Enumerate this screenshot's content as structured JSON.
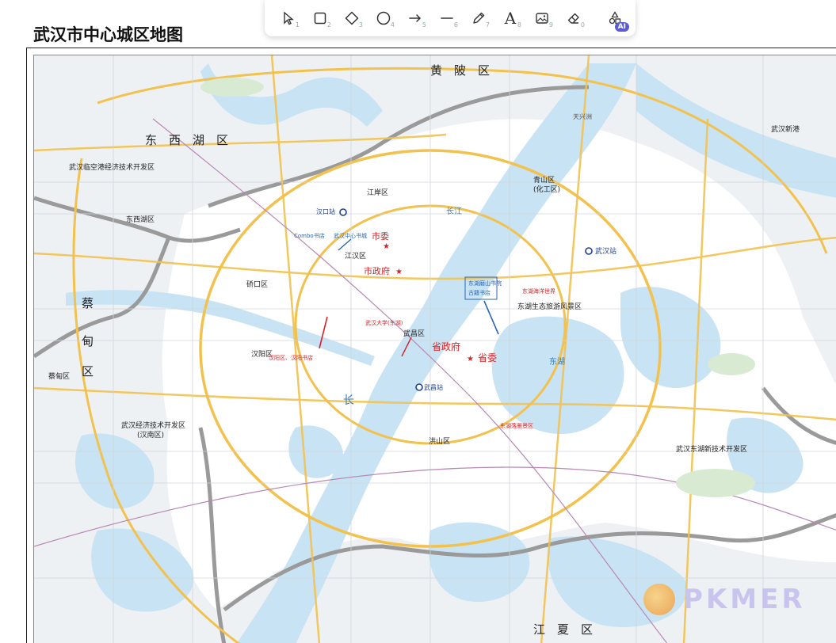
{
  "page": {
    "title": "武汉市中心城区地图"
  },
  "toolbar": {
    "tools": [
      {
        "icon": "select-arrow-icon",
        "key": "1"
      },
      {
        "icon": "rectangle-icon",
        "key": "2"
      },
      {
        "icon": "diamond-icon",
        "key": "3"
      },
      {
        "icon": "ellipse-icon",
        "key": "4"
      },
      {
        "icon": "arrow-icon",
        "key": "5"
      },
      {
        "icon": "line-icon",
        "key": "6"
      },
      {
        "icon": "pencil-icon",
        "key": "7"
      },
      {
        "icon": "text-icon",
        "key": "8",
        "glyph": "A"
      },
      {
        "icon": "image-icon",
        "key": "9"
      },
      {
        "icon": "eraser-icon",
        "key": "0"
      }
    ],
    "ai_label": "AI"
  },
  "map": {
    "districts": [
      "黄　陂　区",
      "东　西　湖　区",
      "蔡",
      "甸",
      "区",
      "江　夏　区",
      "长"
    ],
    "labels": [
      "武汉临空港经济技术开发区",
      "东西湖区",
      "江岸区",
      "汉口站",
      "江汉区",
      "硚口区",
      "青山区",
      "(化工区)",
      "武汉站",
      "东湖生态旅游风景区",
      "武昌区",
      "武昌站",
      "汉阳区",
      "洪山区",
      "武汉经济技术开发区",
      "(汉南区)",
      "武汉东湖新技术开发区",
      "蔡甸区",
      "武汉新港",
      "天兴洲",
      "长江",
      "东湖"
    ],
    "annotations": [
      "市委",
      "市政府",
      "省政府",
      "省委",
      "Combo书店",
      "武汉中心书城",
      "东湖磨山书院",
      "古籍书店",
      "东湖落雁景区",
      "东湖海洋世界",
      "武汉大学(东湖)",
      "汉阳区、汉阳书店"
    ],
    "colors": {
      "water": "#c8e3f3",
      "road_major": "#f2c14e",
      "boundary": "#9a9a9a",
      "annotation_red": "#d1262b",
      "annotation_blue": "#2b66b8",
      "land": "#ffffff"
    }
  },
  "watermark": {
    "text": "PKMER"
  }
}
